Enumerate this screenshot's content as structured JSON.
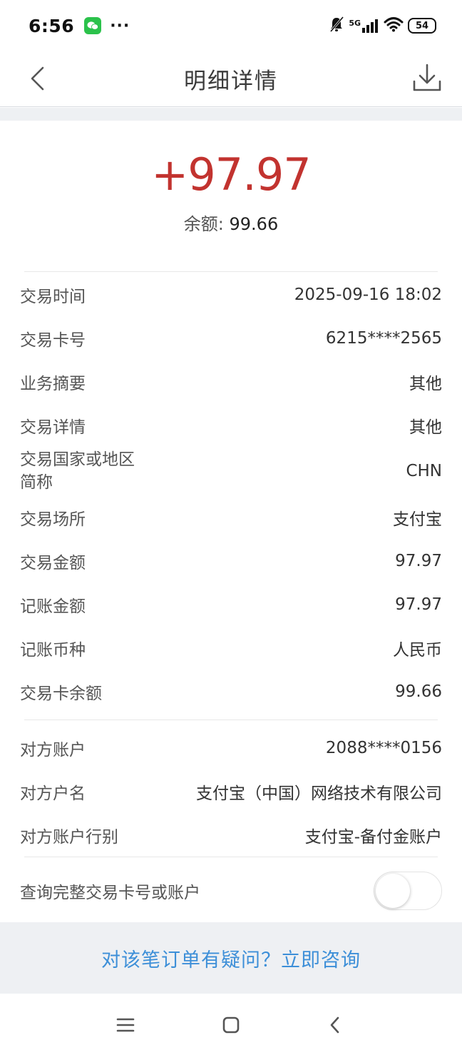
{
  "status_bar": {
    "time": "6:56",
    "dots": "···",
    "network": "5G",
    "battery": "54"
  },
  "nav": {
    "title": "明细详情"
  },
  "summary": {
    "amount": "+97.97",
    "balance_label": "余额: ",
    "balance_value": "99.66"
  },
  "details": [
    {
      "label": "交易时间",
      "value": "2025-09-16 18:02"
    },
    {
      "label": "交易卡号",
      "value": "6215****2565"
    },
    {
      "label": "业务摘要",
      "value": "其他"
    },
    {
      "label": "交易详情",
      "value": "其他"
    },
    {
      "label": "交易国家或地区\n简称",
      "value": "CHN"
    },
    {
      "label": "交易场所",
      "value": "支付宝"
    },
    {
      "label": "交易金额",
      "value": "97.97"
    },
    {
      "label": "记账金额",
      "value": "97.97"
    },
    {
      "label": "记账币种",
      "value": "人民币"
    },
    {
      "label": "交易卡余额",
      "value": "99.66"
    }
  ],
  "counterparty": [
    {
      "label": "对方账户",
      "value": "2088****0156"
    },
    {
      "label": "对方户名",
      "value": "支付宝（中国）网络技术有限公司"
    },
    {
      "label": "对方账户行别",
      "value": "支付宝-备付金账户"
    }
  ],
  "toggle": {
    "label": "查询完整交易卡号或账户",
    "enabled": false
  },
  "consult": {
    "link_text": "对该笔订单有疑问？立即咨询"
  },
  "colors": {
    "amount": "#c2332f",
    "link": "#3d8fd8",
    "band": "#eef0f3"
  }
}
